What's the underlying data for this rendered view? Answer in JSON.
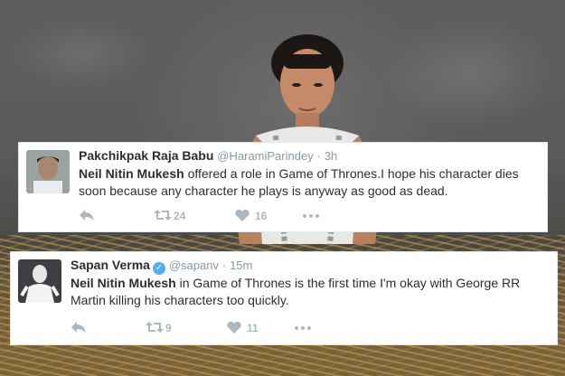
{
  "tweets": [
    {
      "display_name": "Pakchikpak Raja Babu",
      "handle": "@HaramiParindey",
      "separator": "·",
      "time": "3h",
      "verified": false,
      "mention": "Neil Nitin Mukesh",
      "text": " offered a role in Game of Thrones.I hope his character dies soon because any character he plays is anyway as good as dead.",
      "retweets": "24",
      "likes": "16"
    },
    {
      "display_name": "Sapan Verma",
      "handle": "@sapanv",
      "separator": "·",
      "time": "15m",
      "verified": true,
      "mention": "Neil Nitin Mukesh",
      "text": " in Game of Thrones is the first time I'm okay with George RR Martin killing his characters too quickly.",
      "retweets": "9",
      "likes": "11"
    }
  ],
  "icons": {
    "reply": "reply-icon",
    "retweet": "retweet-icon",
    "like": "heart-icon",
    "more": "more-icon"
  },
  "colors": {
    "icon_gray": "#aab8c2",
    "verified_blue": "#55acee",
    "text": "#292f33",
    "meta": "#8899a6"
  }
}
